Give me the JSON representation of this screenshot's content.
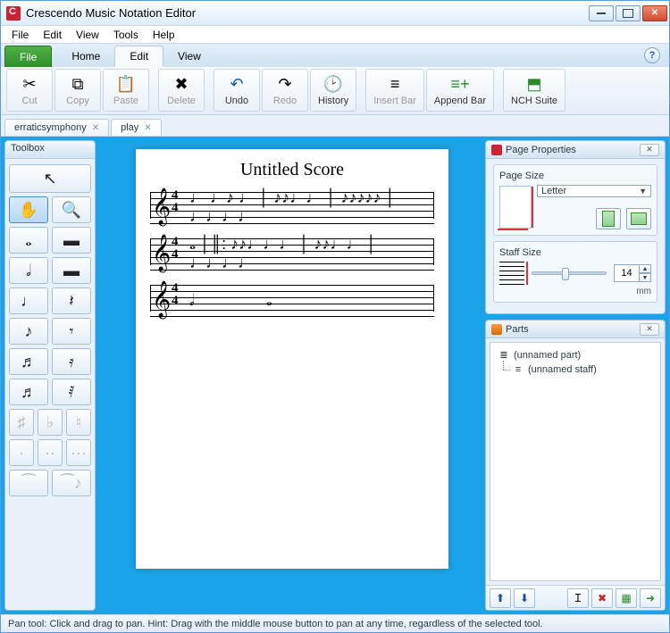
{
  "title": "Crescendo Music Notation Editor",
  "menu": {
    "file": "File",
    "edit": "Edit",
    "view": "View",
    "tools": "Tools",
    "help": "Help"
  },
  "ribbonTabs": {
    "file": "File",
    "home": "Home",
    "edit": "Edit",
    "view": "View"
  },
  "toolbar": {
    "cut": "Cut",
    "copy": "Copy",
    "paste": "Paste",
    "delete": "Delete",
    "undo": "Undo",
    "redo": "Redo",
    "history": "History",
    "insertBar": "Insert Bar",
    "appendBar": "Append Bar",
    "nchSuite": "NCH Suite"
  },
  "docTabs": [
    {
      "label": "erraticsymphony",
      "active": false
    },
    {
      "label": "play",
      "active": true
    }
  ],
  "toolbox": {
    "header": "Toolbox"
  },
  "score": {
    "title": "Untitled Score",
    "timesig": {
      "num": "4",
      "den": "4"
    }
  },
  "pageProps": {
    "header": "Page Properties",
    "pageSizeLabel": "Page Size",
    "pageSizeValue": "Letter",
    "staffSizeLabel": "Staff Size",
    "staffSizeValue": "14",
    "unit": "mm"
  },
  "parts": {
    "header": "Parts",
    "part": "(unnamed part)",
    "staff": "(unnamed staff)"
  },
  "status": "Pan tool: Click and drag to pan. Hint: Drag with the middle mouse button to pan at any time, regardless of the selected tool."
}
